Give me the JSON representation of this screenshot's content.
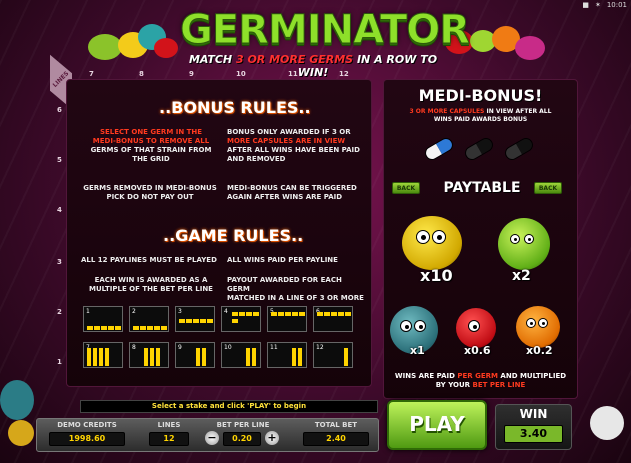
{
  "status": {
    "battery": "■",
    "signal": "✶",
    "time": "10:01"
  },
  "title": "GERMINATOR",
  "subtitle": {
    "pre": "MATCH ",
    "highlight": "3 OR MORE GERMS",
    "post": " IN A ROW TO WIN!"
  },
  "lines_tab": "LINES",
  "line_numbers_top": [
    "7",
    "8",
    "9",
    "10",
    "11",
    "12"
  ],
  "line_numbers_left": [
    "6",
    "5",
    "4",
    "3",
    "2",
    "1"
  ],
  "bonus": {
    "title": "..BONUS RULES..",
    "r1a": "SELECT ONE GERM IN THE",
    "r1b": "MEDI-BONUS TO REMOVE ALL",
    "r1c": "GERMS OF THAT STRAIN FROM",
    "r1d": "THE GRID",
    "r2a": "BONUS ONLY AWARDED IF 3 OR",
    "r2b": "MORE CAPSULES ARE IN VIEW",
    "r2c": "AFTER ALL WINS HAVE BEEN PAID",
    "r2d": "AND REMOVED",
    "r3a": "GERMS REMOVED IN MEDI-BONUS",
    "r3b": "PICK DO NOT PAY OUT",
    "r4a": "MEDI-BONUS CAN BE TRIGGERED",
    "r4b": "AGAIN AFTER WINS ARE PAID"
  },
  "game": {
    "title": "..GAME RULES..",
    "r1": "ALL 12 PAYLINES MUST BE PLAYED",
    "r2": "ALL WINS PAID PER PAYLINE",
    "r3a": "EACH WIN IS AWARDED AS A",
    "r3b": "MULTIPLE OF THE BET PER LINE",
    "r4a": "PAYOUT AWARDED FOR EACH GERM",
    "r4b": "MATCHED IN A LINE OF 3 OR MORE"
  },
  "paylines": [
    "1",
    "2",
    "3",
    "4",
    "5",
    "6",
    "7",
    "8",
    "9",
    "10",
    "11",
    "12"
  ],
  "medi": {
    "title": "MEDI-BONUS!",
    "t1a": "3 OR MORE CAPSULES",
    "t1b": " IN VIEW AFTER ALL",
    "t2": "WINS PAID AWARDS BONUS"
  },
  "paytable": {
    "back_left": "BACK",
    "title": "PAYTABLE",
    "back_right": "BACK",
    "multipliers": [
      "x10",
      "x2",
      "x1",
      "x0.6",
      "x0.2"
    ],
    "paid_a": "WINS ARE PAID ",
    "paid_b": "PER GERM",
    "paid_c": " AND MULTIPLIED",
    "paid_d": "BY YOUR ",
    "paid_e": "BET PER LINE"
  },
  "message": "Select a stake and click 'PLAY' to begin",
  "console": {
    "credits_label": "DEMO CREDITS",
    "credits_value": "1998.60",
    "lines_label": "LINES",
    "lines_value": "12",
    "bet_label": "BET PER LINE",
    "bet_value": "0.20",
    "total_label": "TOTAL BET",
    "total_value": "2.40",
    "minus": "−",
    "plus": "+"
  },
  "play_label": "PLAY",
  "win": {
    "label": "WIN",
    "value": "3.40"
  },
  "colors": {
    "accent_green": "#8ee02a",
    "highlight_red": "#ff3a1f",
    "credit_yellow": "#ffd400"
  }
}
